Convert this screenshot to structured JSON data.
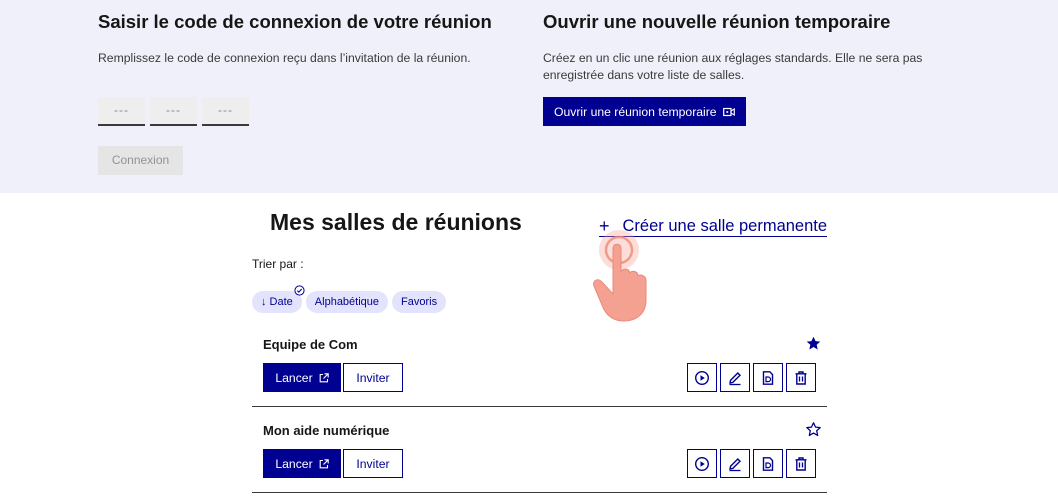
{
  "join": {
    "title": "Saisir le code de connexion de votre réunion",
    "description": "Remplissez le code de connexion reçu dans l’invitation de la réunion.",
    "code_placeholders": [
      "---",
      "---",
      "---"
    ],
    "connect_label": "Connexion"
  },
  "temporary": {
    "title": "Ouvrir une nouvelle réunion temporaire",
    "description": "Créez en un clic une réunion aux réglages standards. Elle ne sera pas enregistrée dans votre liste de salles.",
    "button_label": "Ouvrir une réunion temporaire"
  },
  "rooms": {
    "title": "Mes salles de réunions",
    "create_link": "Créer une salle permanente",
    "create_plus": "+",
    "sort_label": "Trier par :",
    "sort_tags": [
      {
        "label": "↓ Date",
        "selected": true
      },
      {
        "label": "Alphabétique",
        "selected": false
      },
      {
        "label": "Favoris",
        "selected": false
      }
    ],
    "items": [
      {
        "name": "Equipe de Com",
        "favorite": true,
        "launch_label": "Lancer",
        "invite_label": "Inviter"
      },
      {
        "name": "Mon aide numérique",
        "favorite": false,
        "launch_label": "Lancer",
        "invite_label": "Inviter"
      }
    ]
  },
  "colors": {
    "brand": "#000091",
    "band": "#f0f0fa",
    "tag_bg": "#e3e3fd",
    "pointer": "#f4a192"
  }
}
